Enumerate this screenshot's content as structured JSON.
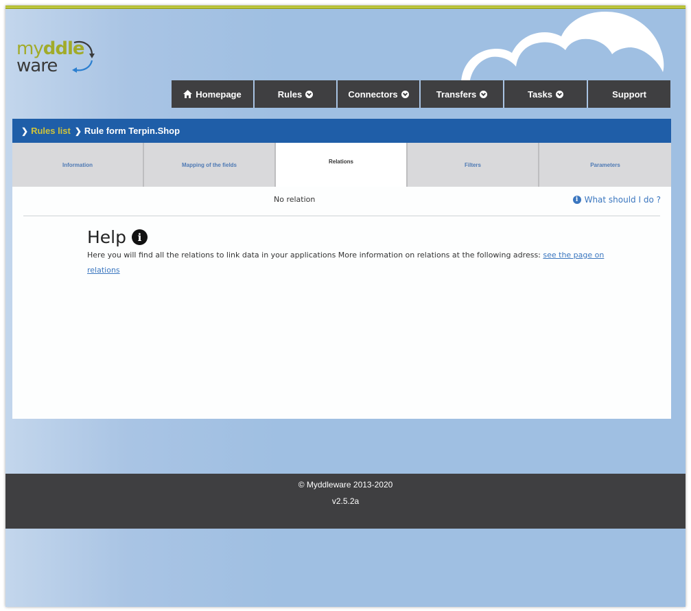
{
  "logo": {
    "line1_prefix": "my",
    "line1_bold": "ddle",
    "line2": "ware"
  },
  "nav": {
    "items": [
      {
        "label": "Homepage",
        "icon": "home-icon"
      },
      {
        "label": "Rules",
        "icon": "chevron-down-icon"
      },
      {
        "label": "Connectors",
        "icon": "chevron-down-icon"
      },
      {
        "label": "Transfers",
        "icon": "chevron-down-icon"
      },
      {
        "label": "Tasks",
        "icon": "chevron-down-icon"
      },
      {
        "label": "Support"
      }
    ]
  },
  "breadcrumb": {
    "link": "Rules list",
    "current": "Rule form Terpin.Shop"
  },
  "tabs": [
    {
      "label": "Information"
    },
    {
      "label": "Mapping of the fields"
    },
    {
      "label": "Relations",
      "active": true
    },
    {
      "label": "Filters"
    },
    {
      "label": "Parameters"
    }
  ],
  "content": {
    "no_relation": "No relation",
    "what_should": "What should I do ?",
    "help_title": "Help",
    "help_text": "Here you will find all the relations to link data in your applications More information on relations at the following adress: ",
    "help_link": "see the page on relations"
  },
  "footer": {
    "copyright": "© Myddleware 2013-2020",
    "version": "v2.5.2a"
  },
  "colors": {
    "nav_bg": "#3f3f41",
    "breadcrumb_bg": "#1f5ea8",
    "link_yellow": "#d1c43a",
    "accent_blue": "#3a76bf",
    "logo_green": "#a1ab2a"
  }
}
